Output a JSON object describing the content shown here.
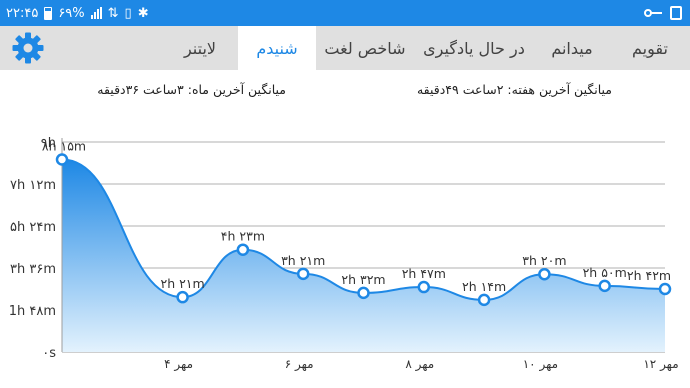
{
  "status_bar": {
    "time": "۲۲:۴۵",
    "battery": "۶۹%",
    "bg_color": "#1e88e5"
  },
  "tabs": [
    {
      "label": "تقویم",
      "active": false
    },
    {
      "label": "میدانم",
      "active": false
    },
    {
      "label": "در حال یادگیری",
      "active": false
    },
    {
      "label": "شاخص لغت",
      "active": false
    },
    {
      "label": "شنیدم",
      "active": true
    },
    {
      "label": "لایتنر",
      "active": false
    }
  ],
  "settings_icon": "gear-icon",
  "averages": {
    "week": "میانگین آخرین هفته: ۲ساعت ۴۹دقیقه",
    "month": "میانگین آخرین ماه: ۳ساعت ۳۶دقیقه"
  },
  "colors": {
    "accent": "#1e88e5",
    "fill_top": "#2196f3",
    "fill_bottom": "#e3f2fd",
    "tab_bar": "#e0e0e0"
  },
  "chart_data": {
    "type": "area",
    "y_ticks": [
      "۰s",
      "1h ۴۸m",
      "۳h ۳۶m",
      "۵h ۲۴m",
      "۷h ۱۲m",
      "۹h"
    ],
    "y_tick_minutes": [
      0,
      108,
      216,
      324,
      432,
      540
    ],
    "ylim": [
      0,
      540
    ],
    "x_tick_labels": [
      "۴ مهر",
      "۶ مهر",
      "۸ مهر",
      "۱۰ مهر",
      "۱۲ مهر"
    ],
    "x_tick_days": [
      4,
      6,
      8,
      10,
      12
    ],
    "grid": true,
    "points": [
      {
        "day": 2,
        "minutes": 495,
        "label": "۸h ۱۵m"
      },
      {
        "day": 4,
        "minutes": 141,
        "label": "۲h ۲۱m"
      },
      {
        "day": 5,
        "minutes": 263,
        "label": "۴h ۲۳m"
      },
      {
        "day": 6,
        "minutes": 201,
        "label": "۳h ۲۱m"
      },
      {
        "day": 7,
        "minutes": 152,
        "label": "۲h ۳۲m"
      },
      {
        "day": 8,
        "minutes": 167,
        "label": "۲h ۴۷m"
      },
      {
        "day": 9,
        "minutes": 134,
        "label": "۲h ۱۴m"
      },
      {
        "day": 10,
        "minutes": 200,
        "label": "۳h ۲۰m"
      },
      {
        "day": 11,
        "minutes": 170,
        "label": "۲h ۵۰m"
      },
      {
        "day": 12,
        "minutes": 162,
        "label": "۲h ۴۲m"
      }
    ]
  }
}
